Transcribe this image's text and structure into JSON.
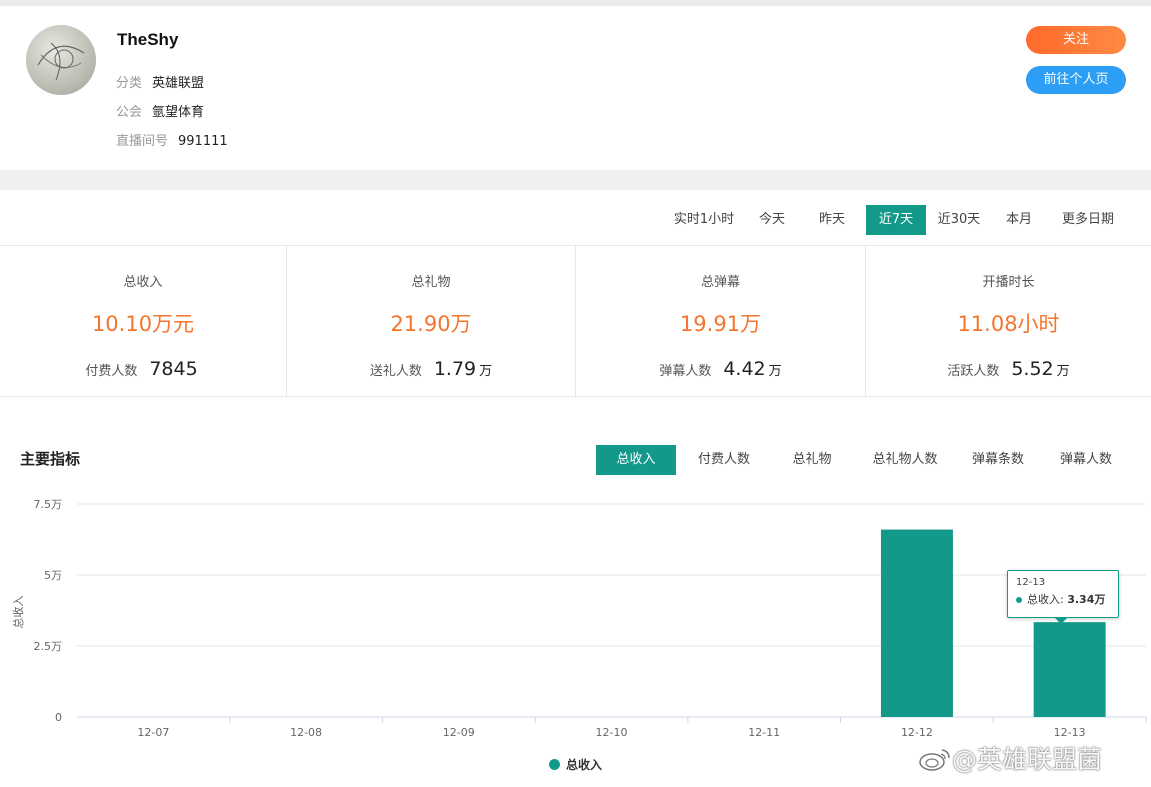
{
  "profile": {
    "name": "TheShy",
    "category_label": "分类",
    "category": "英雄联盟",
    "guild_label": "公会",
    "guild": "氩望体育",
    "room_label": "直播间号",
    "room": "991111",
    "follow_label": "关注",
    "goto_label": "前往个人页"
  },
  "range_tabs": [
    {
      "label": "实时1小时",
      "active": false
    },
    {
      "label": "今天",
      "active": false
    },
    {
      "label": "昨天",
      "active": false
    },
    {
      "label": "近7天",
      "active": true
    },
    {
      "label": "近30天",
      "active": false
    },
    {
      "label": "本月",
      "active": false
    },
    {
      "label": "更多日期",
      "active": false
    }
  ],
  "stats": [
    {
      "label": "总收入",
      "value": "10.10万元",
      "sub_label": "付费人数",
      "sub_value": "7845",
      "sub_unit": ""
    },
    {
      "label": "总礼物",
      "value": "21.90万",
      "sub_label": "送礼人数",
      "sub_value": "1.79",
      "sub_unit": "万"
    },
    {
      "label": "总弹幕",
      "value": "19.91万",
      "sub_label": "弹幕人数",
      "sub_value": "4.42",
      "sub_unit": "万"
    },
    {
      "label": "开播时长",
      "value": "11.08小时",
      "sub_label": "活跃人数",
      "sub_value": "5.52",
      "sub_unit": "万"
    }
  ],
  "section_title": "主要指标",
  "metric_tabs": [
    {
      "label": "总收入",
      "active": true
    },
    {
      "label": "付费人数",
      "active": false
    },
    {
      "label": "总礼物",
      "active": false
    },
    {
      "label": "总礼物人数",
      "active": false
    },
    {
      "label": "弹幕条数",
      "active": false
    },
    {
      "label": "弹幕人数",
      "active": false
    }
  ],
  "chart_data": {
    "type": "bar",
    "categories": [
      "12-07",
      "12-08",
      "12-09",
      "12-10",
      "12-11",
      "12-12",
      "12-13"
    ],
    "series": [
      {
        "name": "总收入",
        "values": [
          0,
          0,
          0,
          0,
          0,
          66000,
          33400
        ]
      }
    ],
    "ylabel": "总收入",
    "ylim": [
      0,
      75000
    ],
    "yticks": [
      "0",
      "2.5万",
      "5万",
      "7.5万"
    ],
    "grid": true,
    "legend": "bottom-center",
    "color": "#13998a"
  },
  "tooltip": {
    "date": "12-13",
    "label": "总收入:",
    "value": "3.34万"
  },
  "watermark": "@英雄联盟菌",
  "colors": {
    "accent": "#13998a",
    "highlight": "#f4752d",
    "follow": "#ff7a35",
    "goto": "#2c9ef5"
  }
}
